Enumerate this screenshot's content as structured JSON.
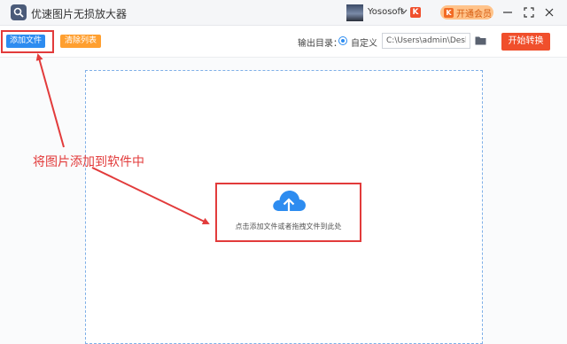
{
  "app": {
    "title": "优速图片无损放大器",
    "username": "Yososoft",
    "brand_badge": "K",
    "vip_icon": "K",
    "vip_label": "开通会员"
  },
  "toolbar": {
    "add_files_label": "添加文件",
    "clear_list_label": "清除列表",
    "output_dir_label": "输出目录：",
    "custom_label": "自定义",
    "output_path_value": "C:\\Users\\admin\\Deskto",
    "start_label": "开始转换"
  },
  "dropzone": {
    "hint": "点击添加文件或者拖拽文件到此处"
  },
  "annotation": {
    "text": "将图片添加到软件中",
    "color": "#e23b3b"
  },
  "colors": {
    "primary": "#2d8cf0",
    "warning": "#ff9f2f",
    "danger": "#f04f2c"
  },
  "icons": [
    "app-logo-icon",
    "chevron-down-icon",
    "minimize-icon",
    "maximize-icon",
    "close-icon",
    "folder-icon",
    "cloud-upload-icon"
  ]
}
